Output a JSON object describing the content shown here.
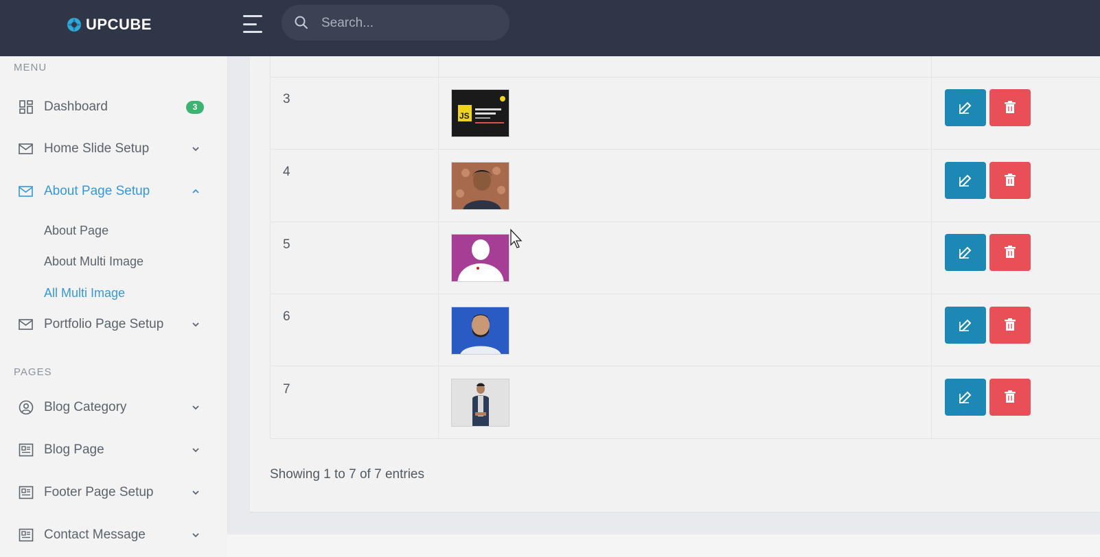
{
  "header": {
    "brand": "UPCUBE",
    "search_placeholder": "Search..."
  },
  "sidebar": {
    "menu_title": "MENU",
    "pages_title": "PAGES",
    "items": [
      {
        "label": "Dashboard",
        "icon": "dashboard-icon",
        "badge": "3"
      },
      {
        "label": "Home Slide Setup",
        "icon": "mail-icon"
      },
      {
        "label": "About Page Setup",
        "icon": "mail-icon",
        "expanded": true
      },
      {
        "label": "Portfolio Page Setup",
        "icon": "mail-icon"
      },
      {
        "label": "Blog Category",
        "icon": "user-circle-icon"
      },
      {
        "label": "Blog Page",
        "icon": "newspaper-icon"
      },
      {
        "label": "Footer Page Setup",
        "icon": "newspaper-icon"
      },
      {
        "label": "Contact Message",
        "icon": "newspaper-icon"
      }
    ],
    "subitems": [
      "About Page",
      "About Multi Image",
      "All Multi Image"
    ]
  },
  "table": {
    "rows": [
      {
        "num": "3",
        "image": "js-thumbnail"
      },
      {
        "num": "4",
        "image": "person-portrait"
      },
      {
        "num": "5",
        "image": "avatar-placeholder"
      },
      {
        "num": "6",
        "image": "man-blue-background"
      },
      {
        "num": "7",
        "image": "man-standing"
      }
    ]
  },
  "entries_text": "Showing 1 to 7 of 7 entries",
  "colors": {
    "topbar": "#2f3647",
    "accent": "#3598dc",
    "edit": "#1e88b4",
    "delete": "#e84f57",
    "badge": "#3cb371"
  }
}
